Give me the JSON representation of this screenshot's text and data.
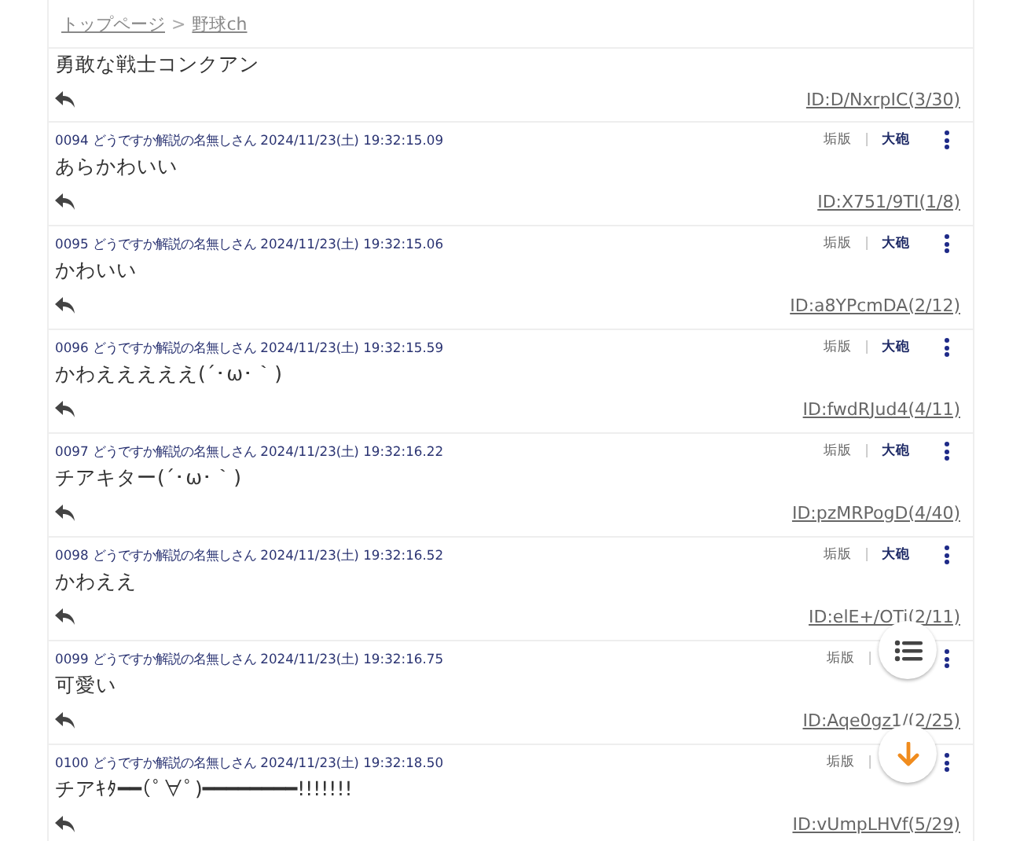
{
  "breadcrumb": [
    {
      "label": "トップページ"
    },
    {
      "label": "野球ch",
      "separator": ">"
    }
  ],
  "posts": [
    {
      "body": "勇敢な戦士コンクアン",
      "id": "ID:D/NxrpIC(3/30)"
    },
    {
      "number": "0094",
      "name": "どうですか解説の名無しさん",
      "date": "2024/11/23(土) 19:32:15.09",
      "ban": "垢版",
      "sep": "|",
      "cannon": "大砲",
      "body": "あらかわいい",
      "id": "ID:X751/9TI(1/8)"
    },
    {
      "number": "0095",
      "name": "どうですか解説の名無しさん",
      "date": "2024/11/23(土) 19:32:15.06",
      "ban": "垢版",
      "sep": "|",
      "cannon": "大砲",
      "body": "かわいい",
      "id": "ID:a8YPcmDA(2/12)"
    },
    {
      "number": "0096",
      "name": "どうですか解説の名無しさん",
      "date": "2024/11/23(土) 19:32:15.59",
      "ban": "垢版",
      "sep": "|",
      "cannon": "大砲",
      "body": "かわえええええ(´･ω･｀)",
      "id": "ID:fwdRJud4(4/11)"
    },
    {
      "number": "0097",
      "name": "どうですか解説の名無しさん",
      "date": "2024/11/23(土) 19:32:16.22",
      "ban": "垢版",
      "sep": "|",
      "cannon": "大砲",
      "body": "チアキター(´･ω･｀)",
      "id": "ID:pzMRPogD(4/40)"
    },
    {
      "number": "0098",
      "name": "どうですか解説の名無しさん",
      "date": "2024/11/23(土) 19:32:16.52",
      "ban": "垢版",
      "sep": "|",
      "cannon": "大砲",
      "body": "かわええ",
      "id": "ID:elE+/OTi(2/11)"
    },
    {
      "number": "0099",
      "name": "どうですか解説の名無しさん",
      "date": "2024/11/23(土) 19:32:16.75",
      "ban": "垢版",
      "sep": "|",
      "body": "可愛い",
      "id": "ID:Aqe0gz1/(2/25)"
    },
    {
      "number": "0100",
      "name": "どうですか解説の名無しさん",
      "date": "2024/11/23(土) 19:32:18.50",
      "ban": "垢版",
      "sep": "|",
      "body": "チアｷﾀ━━(ﾟ∀ﾟ)━━━━━━━━!!!!!!!",
      "id": "ID:vUmpLHVf(5/29)"
    }
  ]
}
